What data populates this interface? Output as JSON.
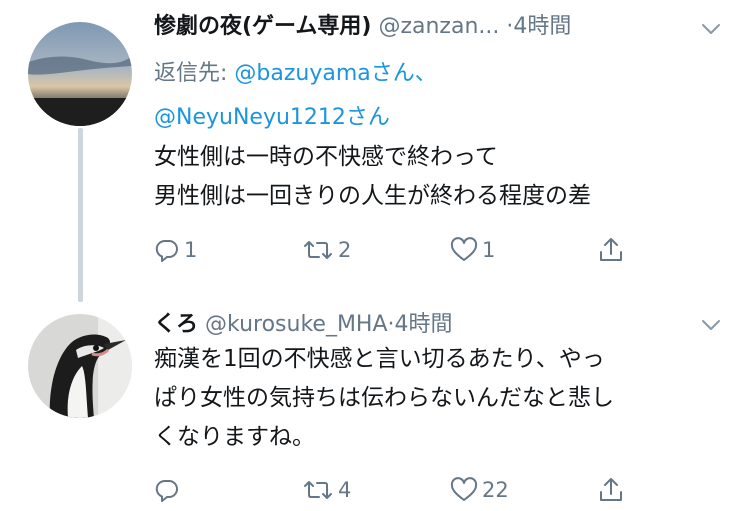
{
  "tweets": [
    {
      "display_name": "惨劇の夜(ゲーム専用)",
      "handle": "@zanzan...",
      "dot": "·",
      "time": "4時間",
      "reply_prefix": "返信先: ",
      "mention1": "@bazuyama",
      "mention1_suffix": "さん、",
      "mention2": "@NeyuNeyu1212",
      "mention2_suffix": "さん",
      "lines": [
        "女性側は一時の不快感で終わって",
        "男性側は一回きりの人生が終わる程度の差"
      ],
      "reply_count": "1",
      "retweet_count": "2",
      "like_count": "1"
    },
    {
      "display_name": "くろ",
      "handle": "@kurosuke_MHA",
      "dot": "·",
      "time": "4時間",
      "lines": [
        "痴漢を1回の不快感と言い切るあたり、やっ",
        "ぱり女性の気持ちは伝わらないんだなと悲し",
        "くなりますね。"
      ],
      "reply_count": "",
      "retweet_count": "4",
      "like_count": "22"
    }
  ],
  "icons": {
    "reply": "reply-icon",
    "retweet": "retweet-icon",
    "like": "heart-icon",
    "share": "share-icon",
    "menu": "chevron-down-icon"
  },
  "colors": {
    "text": "#14171a",
    "secondary": "#657786",
    "link": "#1b95e0",
    "thread_line": "#cdd6dd"
  }
}
